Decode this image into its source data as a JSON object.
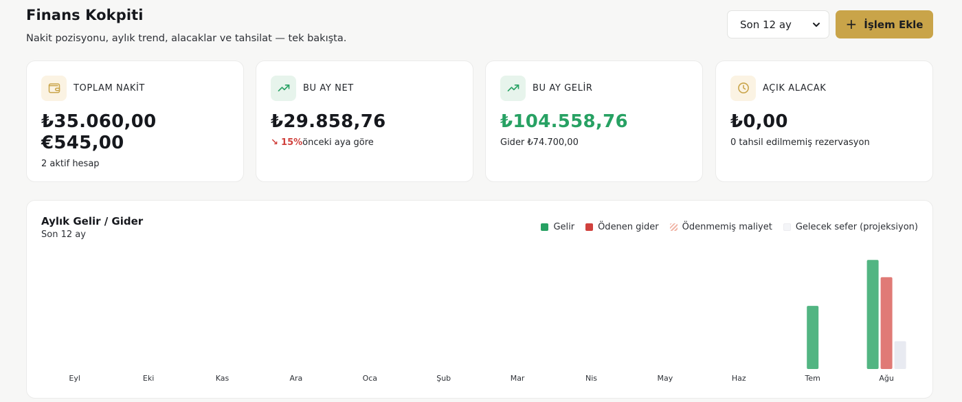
{
  "header": {
    "title": "Finans Kokpiti",
    "subtitle": "Nakit pozisyonu, aylık trend, alacaklar ve tahsilat — tek bakışta."
  },
  "controls": {
    "period_value": "Son 12 ay",
    "add_label": "İşlem Ekle"
  },
  "cards": {
    "cash": {
      "label": "TOPLAM NAKİT",
      "value_try": "₺35.060,00",
      "value_eur": "€545,00",
      "sub": "2 aktif hesap",
      "icon": "wallet-icon"
    },
    "net": {
      "label": "BU AY NET",
      "value": "₺29.858,76",
      "change": "15%",
      "change_text": "önceki aya göre",
      "icon": "trending-up-icon"
    },
    "income": {
      "label": "BU AY GELİR",
      "value": "₺104.558,76",
      "sub": "Gider ₺74.700,00",
      "icon": "trending-up-icon"
    },
    "receivable": {
      "label": "AÇIK ALACAK",
      "value": "₺0,00",
      "sub": "0 tahsil edilmemiş rezervasyon",
      "icon": "clock-icon"
    }
  },
  "colors": {
    "income": "#27a163",
    "paid": "#e07a76",
    "income_bar": "#52b582",
    "future": "#e8eaf1",
    "accent": "#c9a449"
  },
  "chart_data": {
    "type": "bar",
    "title": "Aylık Gelir / Gider",
    "subtitle": "Son 12 ay",
    "categories": [
      "Eyl",
      "Eki",
      "Kas",
      "Ara",
      "Oca",
      "Şub",
      "Mar",
      "Nis",
      "May",
      "Haz",
      "Tem",
      "Ağu"
    ],
    "series": [
      {
        "name": "Gelir",
        "values": [
          0,
          0,
          0,
          0,
          0,
          0,
          0,
          0,
          0,
          0,
          60500,
          104558.76
        ]
      },
      {
        "name": "Ödenen gider",
        "values": [
          0,
          0,
          0,
          0,
          0,
          0,
          0,
          0,
          0,
          0,
          0,
          88000
        ]
      },
      {
        "name": "Ödenmemiş maliyet",
        "values": [
          0,
          0,
          0,
          0,
          0,
          0,
          0,
          0,
          0,
          0,
          0,
          0
        ]
      },
      {
        "name": "Gelecek sefer (projeksiyon)",
        "values": [
          0,
          0,
          0,
          0,
          0,
          0,
          0,
          0,
          0,
          0,
          0,
          26700
        ]
      }
    ],
    "ylim": [
      0,
      110000
    ],
    "grid": false,
    "legend_position": "top-right"
  }
}
